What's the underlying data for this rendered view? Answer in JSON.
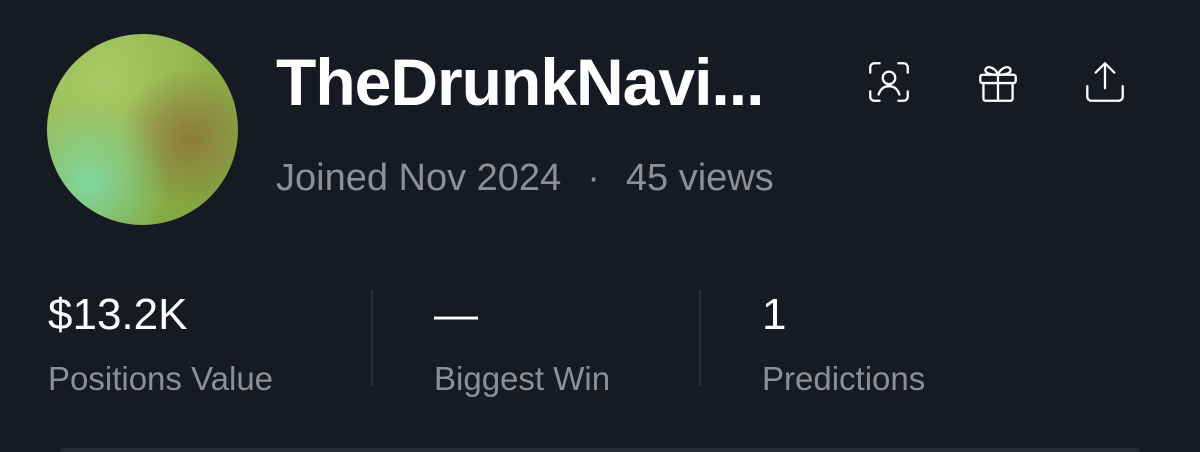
{
  "profile": {
    "username": "TheDrunkNavi...",
    "joined": "Joined Nov 2024",
    "separator": "·",
    "views": "45 views",
    "avatar_colors": [
      "#9bc45e",
      "#7fd8a0",
      "#8e7a3c"
    ]
  },
  "actions": [
    {
      "name": "face-scan-icon",
      "label": "Verify profile"
    },
    {
      "name": "gift-icon",
      "label": "Gift"
    },
    {
      "name": "share-icon",
      "label": "Share"
    }
  ],
  "stats": [
    {
      "value": "$13.2K",
      "label": "Positions Value"
    },
    {
      "value": "—",
      "label": "Biggest Win"
    },
    {
      "value": "1",
      "label": "Predictions"
    }
  ],
  "colors": {
    "background": "#161a22",
    "primary_text": "#ffffff",
    "secondary_text": "#8a8f99",
    "divider": "#2a2f39"
  }
}
